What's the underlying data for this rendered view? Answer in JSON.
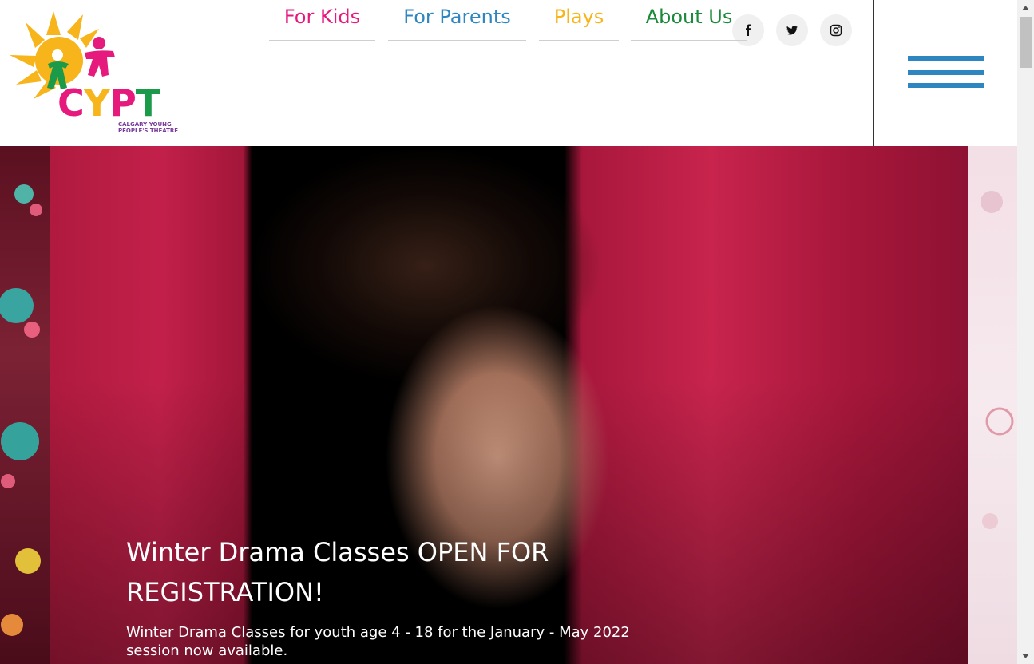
{
  "logo": {
    "letters": [
      "C",
      "Y",
      "P",
      "T"
    ],
    "subtitle": "CALGARY YOUNG PEOPLE'S THEATRE",
    "colors": {
      "c": "#e6197d",
      "y": "#f7b41b",
      "p": "#e6197d",
      "t": "#1b9b4a",
      "sun": "#f7b41b"
    }
  },
  "social": [
    {
      "icon": "facebook-icon",
      "glyph": "f"
    },
    {
      "icon": "twitter-icon"
    },
    {
      "icon": "instagram-icon"
    }
  ],
  "nav": {
    "items": [
      {
        "label": "For Kids",
        "color": "#e6197d"
      },
      {
        "label": "For Parents",
        "color": "#2e86c1"
      },
      {
        "label": "Plays",
        "color": "#f7b41b"
      },
      {
        "label": "About Us",
        "color": "#1b8a3a"
      }
    ]
  },
  "menu": {
    "icon": "hamburger-menu-icon",
    "color": "#2e86c1"
  },
  "hero": {
    "title": "Winter Drama Classes OPEN FOR REGISTRATION!",
    "description": "Winter Drama Classes for youth age 4 - 18 for the January - May 2022 session now available."
  }
}
